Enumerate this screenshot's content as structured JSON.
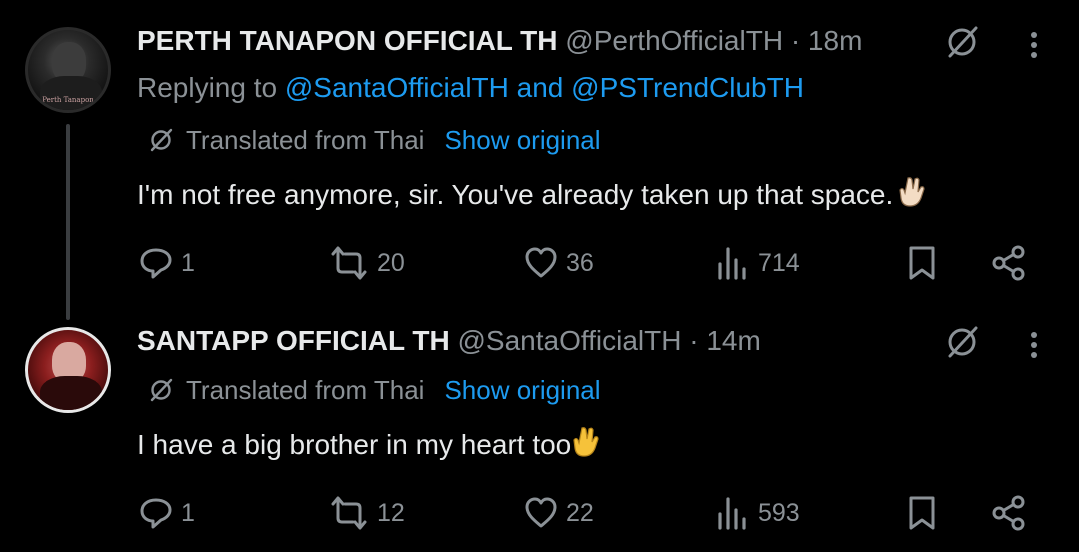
{
  "tweets": [
    {
      "author_name": "PERTH TANAPON OFFICIAL TH",
      "handle": "@PerthOfficialTH",
      "time": "· 18m",
      "avatar_caption": "Perth Tanapon",
      "reply_prefix": "Replying to",
      "reply_to_1": "@SantaOfficialTH",
      "reply_and": "and",
      "reply_to_2": "@PSTrendClubTH",
      "translated_label": "Translated from Thai",
      "show_original": "Show original",
      "text": "I'm not free anymore, sir. You've already taken up that space.",
      "emoji": "🤟",
      "replies": "1",
      "reposts": "20",
      "likes": "36",
      "views": "714"
    },
    {
      "author_name": "SANTAPP OFFICIAL TH",
      "handle": "@SantaOfficialTH",
      "time": "· 14m",
      "translated_label": "Translated from Thai",
      "show_original": "Show original",
      "text": "I have a big brother in my heart too",
      "emoji": "🤟",
      "replies": "1",
      "reposts": "12",
      "likes": "22",
      "views": "593"
    }
  ],
  "colors": {
    "background": "#000000",
    "text": "#e7e9ea",
    "muted": "#8b9196",
    "link": "#1d9bf0"
  },
  "icons": [
    "grok-icon",
    "more-icon",
    "translate-icon",
    "reply-icon",
    "repost-icon",
    "like-icon",
    "views-icon",
    "bookmark-icon",
    "share-icon"
  ]
}
